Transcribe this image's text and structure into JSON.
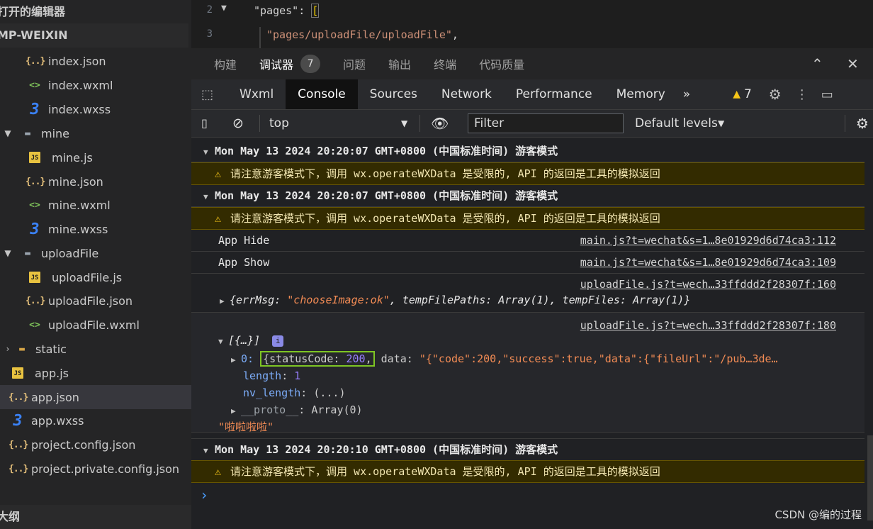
{
  "sidebar": {
    "title_open_editors": "打开的编辑器",
    "title_project": "MP-WEIXIN",
    "outline_title": "大纲",
    "items": [
      {
        "label": "index.json",
        "icon": "json-icon"
      },
      {
        "label": "index.wxml",
        "icon": "wxml-icon"
      },
      {
        "label": "index.wxss",
        "icon": "wxss-icon"
      },
      {
        "label": "mine",
        "icon": "folder-icon"
      },
      {
        "label": "mine.js",
        "icon": "js-icon"
      },
      {
        "label": "mine.json",
        "icon": "json-icon"
      },
      {
        "label": "mine.wxml",
        "icon": "wxml-icon"
      },
      {
        "label": "mine.wxss",
        "icon": "wxss-icon"
      },
      {
        "label": "uploadFile",
        "icon": "folder-icon"
      },
      {
        "label": "uploadFile.js",
        "icon": "js-icon"
      },
      {
        "label": "uploadFile.json",
        "icon": "json-icon"
      },
      {
        "label": "uploadFile.wxml",
        "icon": "wxml-icon"
      },
      {
        "label": "static",
        "icon": "folder-icon"
      },
      {
        "label": "app.js",
        "icon": "js-icon"
      },
      {
        "label": "app.json",
        "icon": "json-icon"
      },
      {
        "label": "app.wxss",
        "icon": "wxss-icon"
      },
      {
        "label": "project.config.json",
        "icon": "json-icon"
      },
      {
        "label": "project.private.config.json",
        "icon": "json-icon"
      }
    ],
    "icon_glyphs": {
      "json": "{..}",
      "js": "JS",
      "wxss": "3",
      "wxml": "<>",
      "folder": "▬"
    }
  },
  "editor": {
    "lines": [
      {
        "num": "2",
        "key": "\"pages\"",
        "colon": ": ",
        "bracket": "["
      },
      {
        "num": "3",
        "value": "\"pages/uploadFile/uploadFile\"",
        "comma": ","
      }
    ]
  },
  "panel": {
    "tabs": [
      "构建",
      "调试器",
      "问题",
      "输出",
      "终端",
      "代码质量"
    ],
    "debugger_badge": "7",
    "collapse_glyph": "⌃",
    "close_glyph": "✕"
  },
  "devtools": {
    "tabs": [
      "Wxml",
      "Console",
      "Sources",
      "Network",
      "Performance",
      "Memory"
    ],
    "more_glyph": "»",
    "warn_count": "7",
    "warn_glyph": "▲"
  },
  "console_toolbar": {
    "context": "top",
    "filter_placeholder": "Filter",
    "levels": "Default levels"
  },
  "console": {
    "group1": "Mon May 13 2024 20:20:07 GMT+0800 (中国标准时间) 游客模式",
    "warn1": "请注意游客模式下，调用 wx.operateWXData 是受限的, API 的返回是工具的模拟返回",
    "group2": "Mon May 13 2024 20:20:07 GMT+0800 (中国标准时间) 游客模式",
    "warn2": "请注意游客模式下，调用 wx.operateWXData 是受限的, API 的返回是工具的模拟返回",
    "log_hide": "App Hide",
    "src_hide": "main.js?t=wechat&s=1…8e01929d6d74ca3:112",
    "log_show": "App Show",
    "src_show": "main.js?t=wechat&s=1…8e01929d6d74ca3:109",
    "src_upload160": "uploadFile.js?t=wech…33ffddd2f28307f:160",
    "obj1_open": "{errMsg: ",
    "obj1_errmsg": "\"chooseImage:ok\"",
    "obj1_rest": ", tempFilePaths: Array(1), tempFiles: Array(1)}",
    "src_upload180": "uploadFile.js?t=wech…33ffddd2f28307f:180",
    "arr_label": "[{…}]",
    "info_glyph": "i",
    "item0_index": "0:",
    "item0_status": "{statusCode: ",
    "item0_status_val": "200",
    "item0_comma": ",",
    "item0_data_key": " data: ",
    "item0_data_val": "\"{\"code\":200,\"success\":true,\"data\":{\"fileUrl\":\"/pub…3de…",
    "length_key": "length",
    "length_val": "1",
    "nvlength_key": "nv_length",
    "nvlength_val": "(...)",
    "proto_key": "__proto__",
    "proto_val": "Array(0)",
    "string_log": "\"啦啦啦啦\"",
    "group3": "Mon May 13 2024 20:20:10 GMT+0800 (中国标准时间) 游客模式",
    "warn3": "请注意游客模式下，调用 wx.operateWXData 是受限的, API 的返回是工具的模拟返回",
    "prompt": "›"
  },
  "watermark": "CSDN @编的过程"
}
